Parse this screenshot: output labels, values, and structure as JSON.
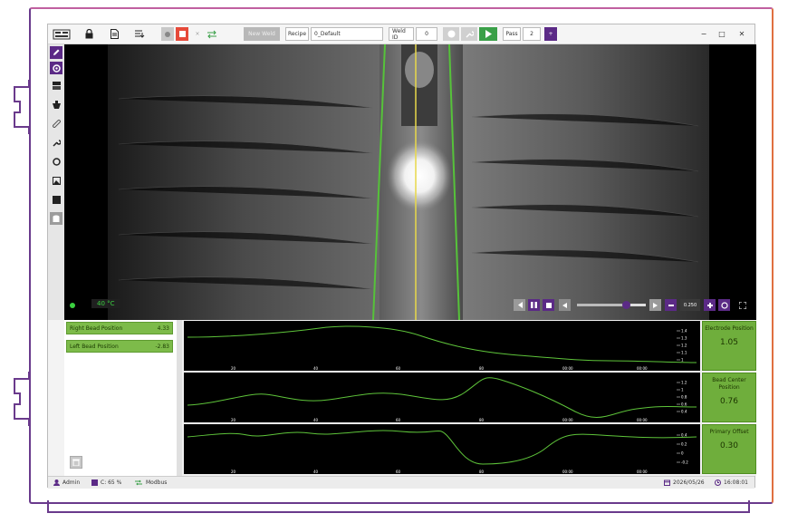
{
  "toolbar": {
    "new_weld_label": "New Weld",
    "recipe_label": "Recipe",
    "recipe_value": "0_Default",
    "weld_id_label": "Weld ID",
    "weld_id_value": "0",
    "pass_label": "Pass",
    "pass_value": "2",
    "pass_increment": "+",
    "window_controls": [
      "−",
      "□",
      "✕"
    ]
  },
  "sidebar": {
    "items": [
      "pencil-icon",
      "gear-active-icon",
      "layers-icon",
      "bucket-icon",
      "ruler-icon",
      "wrench-icon",
      "settings-icon",
      "image-icon",
      "square-icon",
      "database-icon"
    ]
  },
  "video": {
    "temperature": "40 °C",
    "zoom_value": "0.250",
    "playback_progress": 0.72
  },
  "measurements": [
    {
      "label": "Right Bead Position",
      "value": "4.33"
    },
    {
      "label": "Left Bead Position",
      "value": "-2.83"
    }
  ],
  "charts": [
    {
      "y_ticks": [
        "1.4",
        "1.3",
        "1.2",
        "1.1",
        "1"
      ],
      "x_ticks": [
        "20",
        "40",
        "60",
        "80",
        "00:00"
      ]
    },
    {
      "y_ticks": [
        "1.2",
        "1",
        "0.8",
        "0.6",
        "0.4"
      ],
      "x_ticks": [
        "20",
        "40",
        "60",
        "80",
        "00:00"
      ]
    },
    {
      "y_ticks": [
        "0.4",
        "0.2",
        "0",
        "-0.2"
      ],
      "x_ticks": [
        "20",
        "40",
        "60",
        "80",
        "00:00"
      ]
    }
  ],
  "metrics": [
    {
      "label": "Electrode Position",
      "value": "1.05"
    },
    {
      "label": "Bead Center Position",
      "value": "0.76"
    },
    {
      "label": "Primary Offset",
      "value": "0.30"
    }
  ],
  "status": {
    "user": "Admin",
    "storage": "C: 65 %",
    "protocol": "Modbus",
    "date": "2026/05/26",
    "time": "16:08:01"
  },
  "colors": {
    "accent": "#5b2a86",
    "metric_green": "#6fae3c",
    "chart_line": "#5ec43a",
    "stop_red": "#e64a3a"
  }
}
